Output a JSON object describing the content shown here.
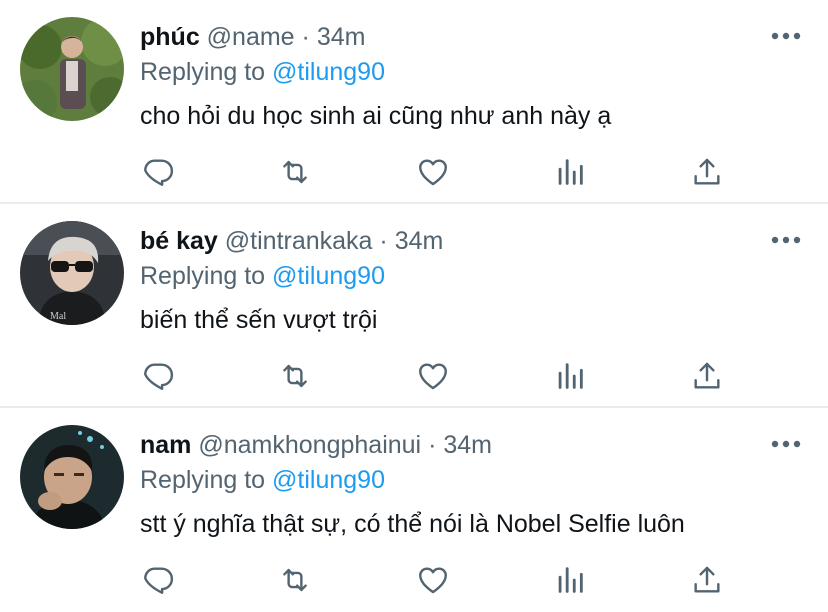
{
  "tweets": [
    {
      "display_name": "phúc",
      "handle": "@name",
      "separator": "·",
      "time": "34m",
      "reply_prefix": "Replying to",
      "reply_handle": "@tilung90",
      "text": "cho hỏi du học sinh ai cũng như anh này ạ"
    },
    {
      "display_name": "bé kay",
      "handle": "@tintrankaka",
      "separator": "·",
      "time": "34m",
      "reply_prefix": "Replying to",
      "reply_handle": "@tilung90",
      "text": "biến thể sến vượt trội"
    },
    {
      "display_name": "nam",
      "handle": "@namkhongphainui",
      "separator": "·",
      "time": "34m",
      "reply_prefix": "Replying to",
      "reply_handle": "@tilung90",
      "text": "stt ý nghĩa thật sự, có thể nói là Nobel Selfie luôn"
    }
  ],
  "icons": {
    "more": "more-horizontal-icon",
    "reply": "reply-icon",
    "retweet": "retweet-icon",
    "like": "heart-icon",
    "analytics": "analytics-icon",
    "share": "share-icon"
  },
  "colors": {
    "text": "#0f1419",
    "secondary": "#536471",
    "link": "#1d9bf0",
    "divider": "#e6ecf0"
  }
}
